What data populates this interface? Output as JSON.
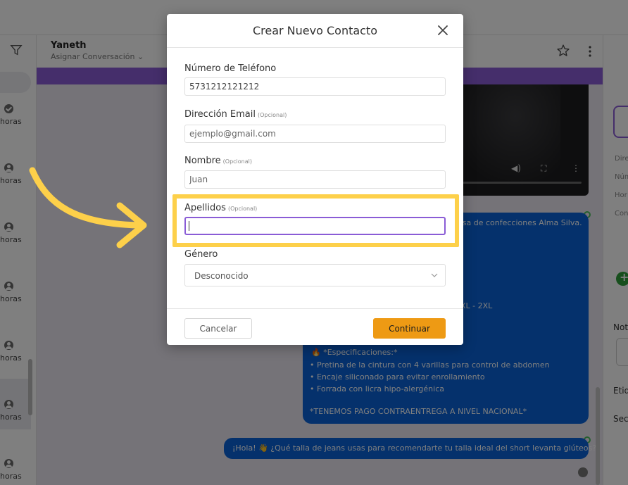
{
  "app": {
    "contact_name": "Yaneth",
    "assign_label": "Asignar Conversación",
    "conversation_times": [
      "horas",
      "horas",
      "horas",
      "horas",
      "horas",
      "horas",
      "horas"
    ],
    "messages": {
      "main_lines": [
        "esa de confecciones Alma Silva.",
        "XL - 2XL",
        "*Especificaciones:*",
        "• Pretina de la cintura con 4 varillas para control de abdomen",
        "• Encaje siliconado para evitar enrollamiento",
        "• Forrada con licra hipo-alergénica",
        "*TENEMOS PAGO CONTRAENTREGA A NIVEL NACIONAL*"
      ],
      "last": "¡Hola! 👋 ¿Qué talla de jeans usas para recomendarte tu talla ideal del short levanta glúteos?"
    },
    "right_panel": {
      "labels": [
        "Dire",
        "Núm",
        "Hor",
        "Con"
      ],
      "headings": [
        "Not",
        "Etiq",
        "Sec"
      ]
    }
  },
  "modal": {
    "title": "Crear Nuevo Contacto",
    "optional_tag": "(Opcional)",
    "fields": {
      "phone": {
        "label": "Número de Teléfono",
        "value": "5731212121212"
      },
      "email": {
        "label": "Dirección Email",
        "placeholder": "ejemplo@gmail.com"
      },
      "first_name": {
        "label": "Nombre",
        "placeholder": "Juan"
      },
      "last_name": {
        "label": "Apellidos",
        "value": ""
      },
      "gender": {
        "label": "Género",
        "selected": "Desconocido"
      }
    },
    "cancel_label": "Cancelar",
    "continue_label": "Continuar"
  },
  "colors": {
    "accent_purple": "#8a5cd6",
    "bubble_blue": "#0b63d8",
    "continue_orange": "#ee9a14",
    "highlight_yellow": "#fdd04a"
  },
  "icons": [
    "filter-icon",
    "star-icon",
    "kebab-icon",
    "close-icon",
    "chevron-down-icon",
    "check-icon",
    "user-icon",
    "arrow-annotation"
  ]
}
